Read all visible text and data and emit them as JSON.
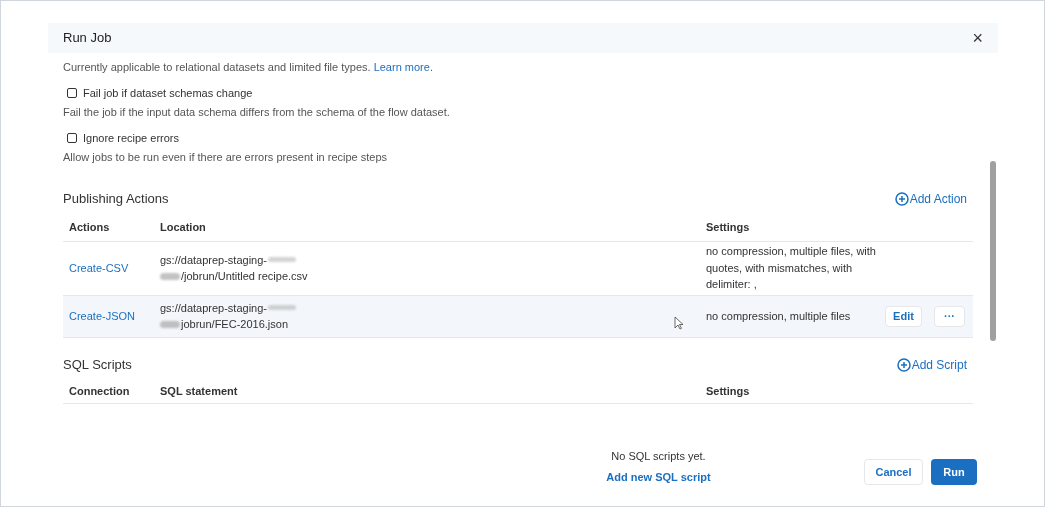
{
  "dialog": {
    "title": "Run Job",
    "close": "×"
  },
  "intro": {
    "text": "Currently applicable to relational datasets and limited file types.",
    "link": "Learn more."
  },
  "options": [
    {
      "label": "Fail job if dataset schemas change",
      "checked": false,
      "help": "Fail the job if the input data schema differs from the schema of the flow dataset."
    },
    {
      "label": "Ignore recipe errors",
      "checked": false,
      "help": "Allow jobs to be run even if there are errors present in recipe steps"
    }
  ],
  "publishing": {
    "title": "Publishing Actions",
    "add": "Add Action",
    "columns": [
      "Actions",
      "Location",
      "Settings"
    ],
    "rows": [
      {
        "action": "Create-CSV",
        "location": [
          "gs://dataprep-staging-",
          "/jobrun/Untitled recipe.csv"
        ],
        "settings": "no compression, multiple files, with quotes, with mismatches, with delimiter: ,",
        "selected": false
      },
      {
        "action": "Create-JSON",
        "location": [
          "gs://dataprep-staging-",
          "jobrun/FEC-2016.json"
        ],
        "settings": "no compression, multiple files",
        "selected": true,
        "buttons": [
          "Edit",
          "···"
        ]
      }
    ]
  },
  "sql": {
    "title": "SQL Scripts",
    "add": "Add Script",
    "columns": [
      "Connection",
      "SQL statement",
      "Settings"
    ],
    "empty": "No SQL scripts yet.",
    "empty_link": "Add new SQL script"
  },
  "footer": {
    "buttons": [
      {
        "label": "Cancel",
        "kind": "secondary"
      },
      {
        "label": "Run",
        "kind": "primary"
      }
    ]
  }
}
